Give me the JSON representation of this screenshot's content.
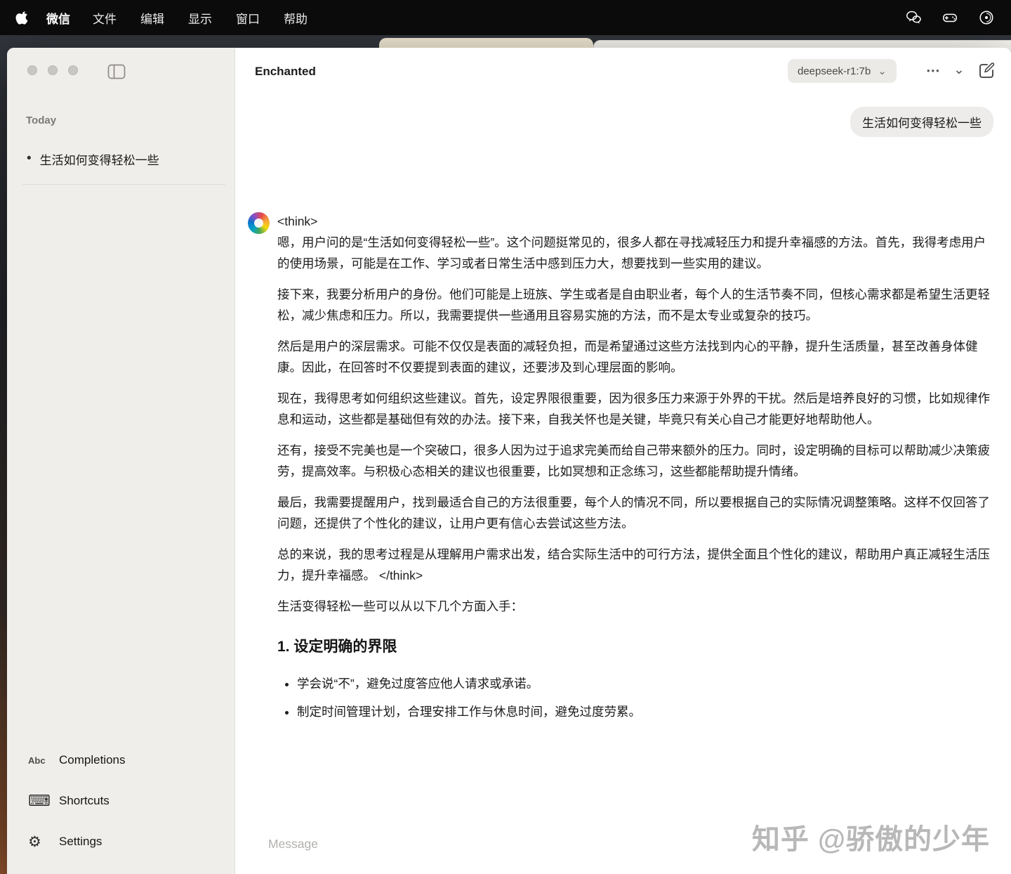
{
  "menubar": {
    "app_name": "微信",
    "menus": [
      "文件",
      "编辑",
      "显示",
      "窗口",
      "帮助"
    ]
  },
  "sidebar": {
    "section_label": "Today",
    "conversation_title": "生活如何变得轻松一些",
    "footer": {
      "completions": "Completions",
      "shortcuts": "Shortcuts",
      "settings": "Settings"
    }
  },
  "header": {
    "title": "Enchanted",
    "model": "deepseek-r1:7b"
  },
  "chat": {
    "user_message": "生活如何变得轻松一些",
    "assistant": {
      "think_open": "<think>",
      "paragraphs": [
        "嗯，用户问的是“生活如何变得轻松一些”。这个问题挺常见的，很多人都在寻找减轻压力和提升幸福感的方法。首先，我得考虑用户的使用场景，可能是在工作、学习或者日常生活中感到压力大，想要找到一些实用的建议。",
        "接下来，我要分析用户的身份。他们可能是上班族、学生或者是自由职业者，每个人的生活节奏不同，但核心需求都是希望生活更轻松，减少焦虑和压力。所以，我需要提供一些通用且容易实施的方法，而不是太专业或复杂的技巧。",
        "然后是用户的深层需求。可能不仅仅是表面的减轻负担，而是希望通过这些方法找到内心的平静，提升生活质量，甚至改善身体健康。因此，在回答时不仅要提到表面的建议，还要涉及到心理层面的影响。",
        "现在，我得思考如何组织这些建议。首先，设定界限很重要，因为很多压力来源于外界的干扰。然后是培养良好的习惯，比如规律作息和运动，这些都是基础但有效的办法。接下来，自我关怀也是关键，毕竟只有关心自己才能更好地帮助他人。",
        "还有，接受不完美也是一个突破口，很多人因为过于追求完美而给自己带来额外的压力。同时，设定明确的目标可以帮助减少决策疲劳，提高效率。与积极心态相关的建议也很重要，比如冥想和正念练习，这些都能帮助提升情绪。",
        "最后，我需要提醒用户，找到最适合自己的方法很重要，每个人的情况不同，所以要根据自己的实际情况调整策略。这样不仅回答了问题，还提供了个性化的建议，让用户更有信心去尝试这些方法。",
        "总的来说，我的思考过程是从理解用户需求出发，结合实际生活中的可行方法，提供全面且个性化的建议，帮助用户真正减轻生活压力，提升幸福感。 </think>"
      ],
      "outro": "生活变得轻松一些可以从以下几个方面入手：",
      "heading": "1. 设定明确的界限",
      "bullets": [
        "学会说“不”，避免过度答应他人请求或承诺。",
        "制定时间管理计划，合理安排工作与休息时间，避免过度劳累。"
      ]
    }
  },
  "composer": {
    "placeholder": "Message"
  },
  "watermark": "知乎 @骄傲的少年",
  "icons": {
    "abc_glyph": "Abc",
    "keyboard_glyph": "⌨",
    "gear_glyph": "⚙",
    "ellipsis_glyph": "•••",
    "chevron_glyph": "⌄"
  },
  "colors": {
    "menubar_bg": "#0b0b0c",
    "sidebar_bg": "#f0eeeb",
    "pill_bg": "#eceae7",
    "bubble_bg": "#edecea"
  }
}
